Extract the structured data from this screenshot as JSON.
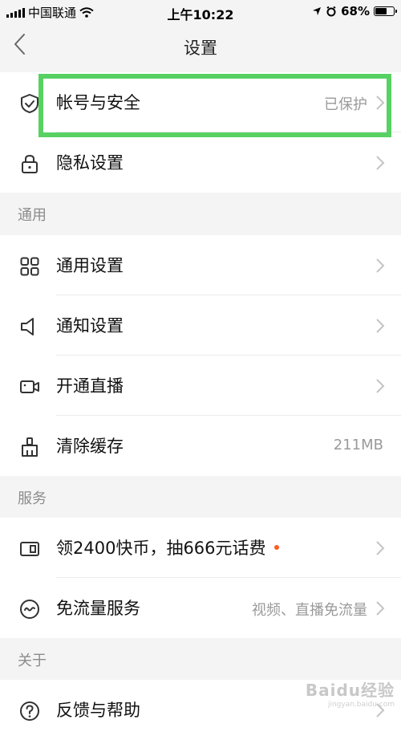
{
  "status_bar": {
    "carrier": "中国联通",
    "time": "上午10:22",
    "battery": "68%",
    "battery_level": 0.68
  },
  "nav": {
    "title": "设置",
    "back_icon": "chevron-left-icon"
  },
  "account_group": [
    {
      "label": "帐号与安全",
      "value": "已保护",
      "icon": "shield-check-icon",
      "arrow": true
    },
    {
      "label": "隐私设置",
      "value": "",
      "icon": "lock-icon",
      "arrow": true
    }
  ],
  "sections": {
    "general": "通用",
    "services": "服务",
    "about": "关于"
  },
  "general_group": [
    {
      "label": "通用设置",
      "value": "",
      "icon": "grid-icon",
      "arrow": true
    },
    {
      "label": "通知设置",
      "value": "",
      "icon": "speaker-icon",
      "arrow": true
    },
    {
      "label": "开通直播",
      "value": "",
      "icon": "video-camera-icon",
      "arrow": true
    },
    {
      "label": "清除缓存",
      "value": "211MB",
      "icon": "broom-icon",
      "arrow": false
    }
  ],
  "services_group": [
    {
      "label": "领2400快币，抽666元话费",
      "value": "",
      "icon": "coupon-icon",
      "arrow": true,
      "badge_dot": true
    },
    {
      "label": "免流量服务",
      "value": "视频、直播免流量",
      "icon": "wave-circle-icon",
      "arrow": true
    }
  ],
  "about_group": [
    {
      "label": "反馈与帮助",
      "value": "",
      "icon": "question-icon",
      "arrow": true
    }
  ],
  "colors": {
    "highlight": "#58d163",
    "badge_dot": "#ff5a1f",
    "background": "#f4f4f4"
  },
  "watermark": {
    "logo": "Baidu经验",
    "sub": "jingyan.baidu.com"
  }
}
